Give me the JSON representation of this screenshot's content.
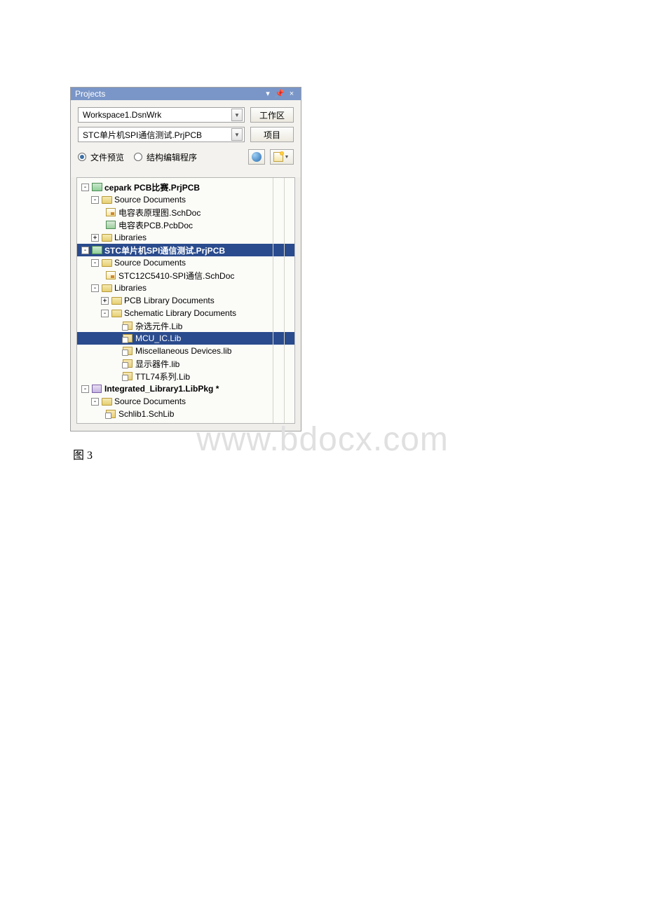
{
  "panel": {
    "title": "Projects"
  },
  "workspace": {
    "value": "Workspace1.DsnWrk",
    "button": "工作区"
  },
  "project": {
    "value": "STC单片机SPI通信测试.PrjPCB",
    "button": "项目"
  },
  "view": {
    "radio1": "文件预览",
    "radio2": "结构编辑程序"
  },
  "tree": {
    "p1": {
      "name": "cepark PCB比赛.PrjPCB",
      "src": "Source Documents",
      "f1": "电容表原理图.SchDoc",
      "f2": "电容表PCB.PcbDoc",
      "libs": "Libraries"
    },
    "p2": {
      "name": "STC单片机SPI通信测试.PrjPCB",
      "src": "Source Documents",
      "f1": "STC12C5410-SPI通信.SchDoc",
      "libs": "Libraries",
      "pcblib": "PCB Library Documents",
      "schlib": "Schematic Library Documents",
      "l1": "杂选元件.Lib",
      "l2": "MCU_IC.Lib",
      "l3": "Miscellaneous Devices.lib",
      "l4": "显示器件.lib",
      "l5": "TTL74系列.Lib"
    },
    "p3": {
      "name": "Integrated_Library1.LibPkg *",
      "src": "Source Documents",
      "f1": "Schlib1.SchLib"
    }
  },
  "caption": "图 3",
  "watermark": "www.bdocx.com"
}
